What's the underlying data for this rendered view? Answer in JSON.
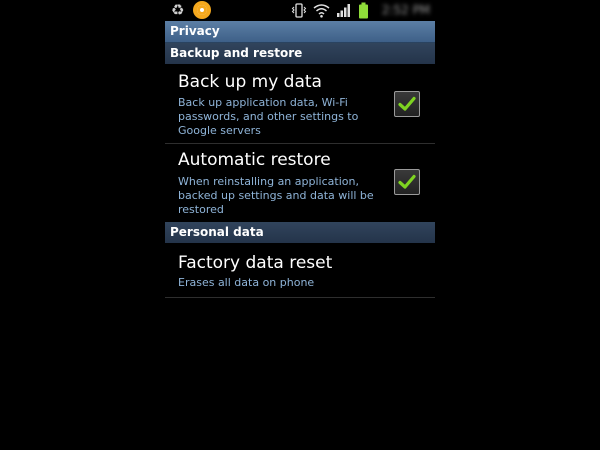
{
  "status_bar": {
    "clock": "2:52 PM",
    "icons": [
      "recycle-icon",
      "aim-icon",
      "vibrate-icon",
      "wifi-icon",
      "signal-icon",
      "battery-icon"
    ]
  },
  "title": "Privacy",
  "sections": [
    {
      "header": "Backup and restore",
      "items": [
        {
          "title": "Back up my data",
          "summary": "Back up application data, Wi-Fi passwords, and other settings to Google servers",
          "checked": true
        },
        {
          "title": "Automatic restore",
          "summary": "When reinstalling an application, backed up settings and data will be restored",
          "checked": true
        }
      ]
    },
    {
      "header": "Personal data",
      "items": [
        {
          "title": "Factory data reset",
          "summary": "Erases all data on phone"
        }
      ]
    }
  ],
  "colors": {
    "title_bar": "#4e7098",
    "section_header": "#2b3c52",
    "summary_text": "#8fb4d8",
    "check_mark": "#7ed321"
  }
}
